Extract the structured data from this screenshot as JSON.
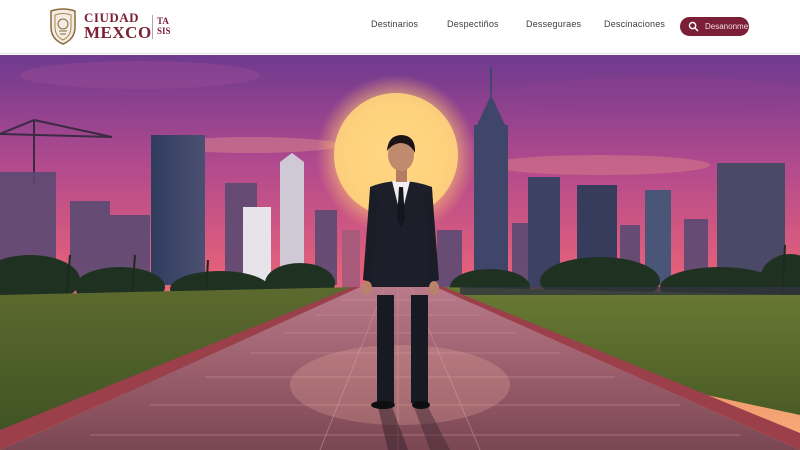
{
  "header": {
    "logo": {
      "line1": "CIUDAD",
      "line2": "MEXCO",
      "side_line1": "TA",
      "side_line2": "SIS"
    },
    "nav": [
      {
        "label": "Destinarios"
      },
      {
        "label": "Despectiños"
      },
      {
        "label": "Desseguraes"
      },
      {
        "label": "Descinaciones"
      }
    ],
    "search": {
      "icon": "search-icon",
      "label": "Desanonme"
    },
    "accent_color": "#7b1f38"
  },
  "hero": {
    "image": "sunset-city-skyline-with-man-in-suit-on-stone-walkway",
    "palette": {
      "sky_top": "#7e3a8e",
      "sky_mid": "#d9577d",
      "sky_low": "#f08a5d",
      "sun": "#ffd27a"
    }
  }
}
